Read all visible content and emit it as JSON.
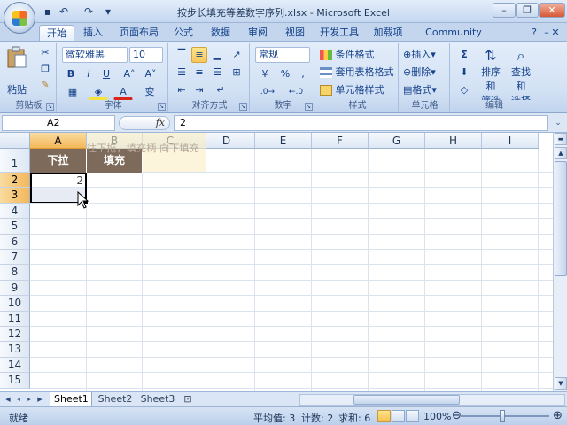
{
  "window": {
    "title": "按步长填充等差数字序列.xlsx - Microsoft Excel",
    "min": "–",
    "max": "❐",
    "close": "✕",
    "doc_min": "–",
    "doc_max": "❐",
    "doc_close": "✕"
  },
  "qat": {
    "save": "▪",
    "undo": "↶",
    "redo": "↷",
    "more": "▾"
  },
  "tabs": [
    "开始",
    "插入",
    "页面布局",
    "公式",
    "数据",
    "审阅",
    "视图",
    "开发工具",
    "加载项",
    "Community Clips"
  ],
  "ribbon": {
    "clipboard": {
      "label": "剪贴板",
      "paste": "粘贴"
    },
    "font": {
      "label": "字体",
      "name": "微软雅黑",
      "size": "10",
      "bold": "B",
      "italic": "I",
      "underline": "U",
      "grow": "A˄",
      "shrink": "A˅",
      "color": "A",
      "wen": "变"
    },
    "alignment": {
      "label": "对齐方式"
    },
    "number": {
      "label": "数字",
      "format": "常规",
      "percent": "%",
      "comma": ","
    },
    "styles": {
      "label": "样式",
      "cond": "条件格式",
      "table": "套用表格格式",
      "cellstyle": "单元格样式"
    },
    "cells": {
      "label": "单元格",
      "insert": "插入",
      "delete": "删除",
      "format": "格式"
    },
    "editing": {
      "label": "编辑",
      "sigma": "Σ",
      "sort": "排序和",
      "sort2": "筛选",
      "find": "查找和",
      "find2": "选择"
    }
  },
  "formula": {
    "namebox": "A2",
    "fx": "fx",
    "value": "2"
  },
  "grid": {
    "columns": [
      "A",
      "B",
      "C",
      "D",
      "E",
      "F",
      "G",
      "H",
      "I"
    ],
    "rows": [
      "1",
      "2",
      "3",
      "4",
      "5",
      "6",
      "7",
      "8",
      "9",
      "10",
      "11",
      "12",
      "13",
      "14",
      "15"
    ],
    "a1": "下拉",
    "b1": "填充",
    "a2": "2",
    "tooltip": "往下拖，填充柄  向下填充"
  },
  "sheets": [
    "Sheet1",
    "Sheet2",
    "Sheet3"
  ],
  "status": {
    "mode": "就绪",
    "average": "平均值: 3",
    "count": "计数: 2",
    "sum": "求和: 6",
    "zoom": "100%"
  },
  "colors": {
    "header_fill": "#7d6a5a",
    "accent": "#15428b"
  }
}
